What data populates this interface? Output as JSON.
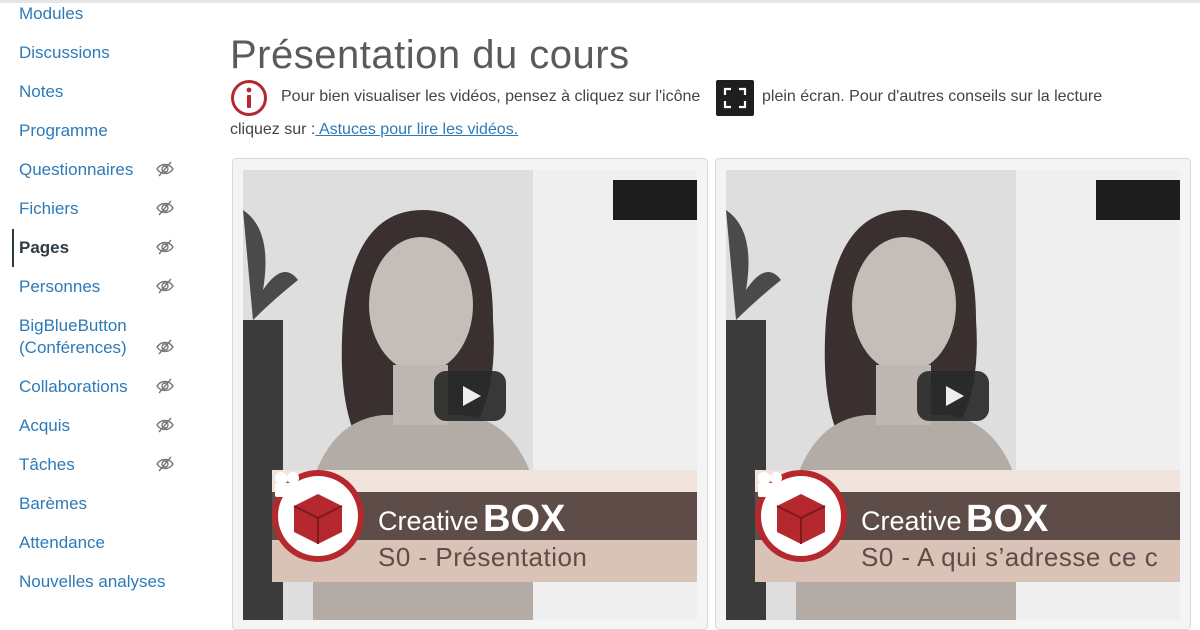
{
  "sidebar": {
    "items": [
      {
        "label": "Modules",
        "hidden": false
      },
      {
        "label": "Discussions",
        "hidden": false
      },
      {
        "label": "Notes",
        "hidden": false
      },
      {
        "label": "Programme",
        "hidden": false
      },
      {
        "label": "Questionnaires",
        "hidden": true
      },
      {
        "label": "Fichiers",
        "hidden": true
      },
      {
        "label": "Pages",
        "hidden": true,
        "active": true
      },
      {
        "label": "Personnes",
        "hidden": true
      },
      {
        "label": "BigBlueButton",
        "label2": "(Conférences)",
        "hidden": true
      },
      {
        "label": "Collaborations",
        "hidden": true
      },
      {
        "label": "Acquis",
        "hidden": true
      },
      {
        "label": "Tâches",
        "hidden": true
      },
      {
        "label": "Barèmes",
        "hidden": false
      },
      {
        "label": "Attendance",
        "hidden": false
      },
      {
        "label": "Nouvelles analyses",
        "hidden": false
      }
    ]
  },
  "page": {
    "title": "Présentation du cours",
    "info_text_before_icon": "Pour bien visualiser les vidéos, pensez à cliquez sur l'icône",
    "info_text_after_icon": "plein écran. Pour d'autres conseils sur la lecture",
    "info_line2_prefix": "cliquez sur :",
    "info_link": " Astuces pour lire les vidéos."
  },
  "videos": [
    {
      "brand_light": "Creative",
      "brand_bold": "BOX",
      "subtitle": "S0 - Présentation"
    },
    {
      "brand_light": "Creative",
      "brand_bold": "BOX",
      "subtitle": "S0 - A qui s’adresse ce c"
    }
  ],
  "colors": {
    "link": "#2d7ab8",
    "info_icon": "#b5282e",
    "banner_dark": "#5e4c49",
    "logo_red": "#b5282e"
  }
}
